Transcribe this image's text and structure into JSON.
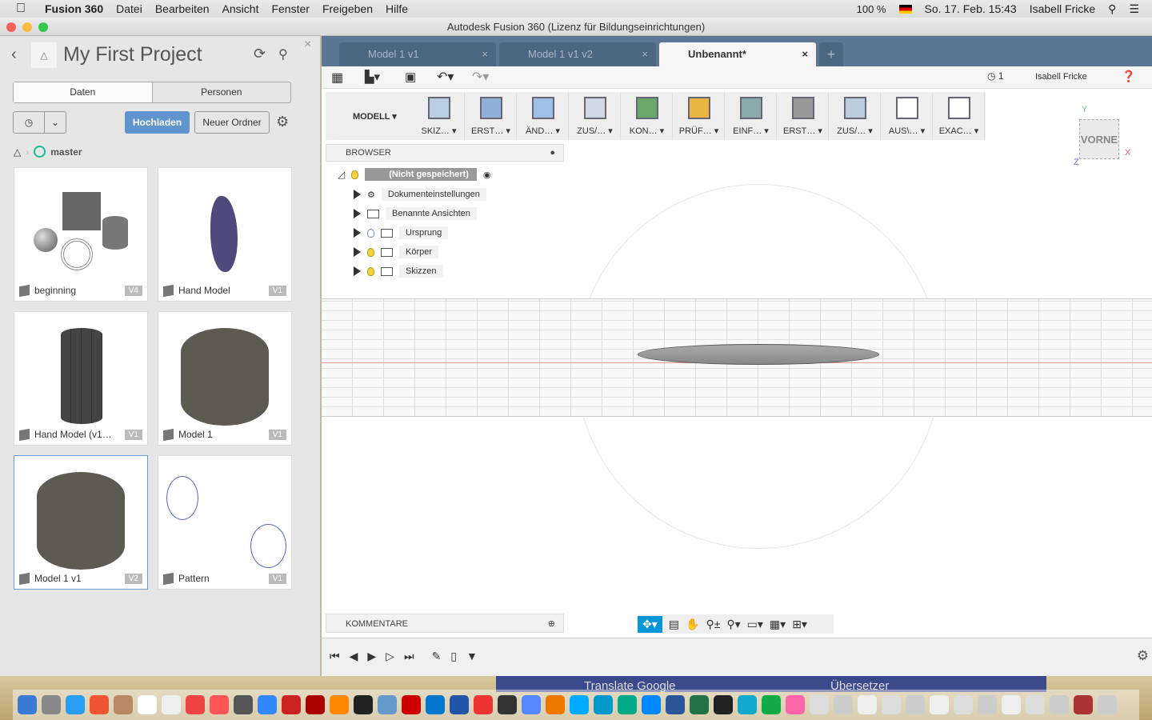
{
  "menubar": {
    "app": "Fusion 360",
    "items": [
      "Datei",
      "Bearbeiten",
      "Ansicht",
      "Fenster",
      "Freigeben",
      "Hilfe"
    ],
    "battery": "100 %",
    "datetime": "So. 17. Feb.  15:43",
    "user": "Isabell Fricke"
  },
  "window": {
    "title": "Autodesk Fusion 360 (Lizenz für Bildungseinrichtungen)"
  },
  "project": {
    "title": "My First Project",
    "tabs": [
      "Daten",
      "Personen"
    ],
    "upload": "Hochladen",
    "new_folder": "Neuer Ordner",
    "branch": "master",
    "files": [
      {
        "name": "beginning",
        "version": "V4"
      },
      {
        "name": "Hand Model",
        "version": "V1"
      },
      {
        "name": "Hand Model (v1…",
        "version": "V1"
      },
      {
        "name": "Model 1",
        "version": "V1"
      },
      {
        "name": "Model 1 v1",
        "version": "V2"
      },
      {
        "name": "Pattern",
        "version": "V1"
      }
    ]
  },
  "doc_tabs": [
    {
      "label": "Model 1 v1"
    },
    {
      "label": "Model 1 v1 v2"
    },
    {
      "label": "Unbenannt*"
    }
  ],
  "qat": {
    "jobs": "1",
    "user": "Isabell Fricke"
  },
  "ribbon": {
    "workspace": "MODELL",
    "groups": [
      "SKIZ…",
      "ERST…",
      "ÄND…",
      "ZUS/…",
      "KON…",
      "PRÜF…",
      "EINF…",
      "ERST…",
      "ZUS/…",
      "AUS\\…",
      "EXAC…"
    ]
  },
  "browser": {
    "title": "BROWSER",
    "root": "(Nicht gespeichert)",
    "items": [
      "Dokumenteinstellungen",
      "Benannte Ansichten",
      "Ursprung",
      "Körper",
      "Skizzen"
    ]
  },
  "viewcube": {
    "face": "VORNE",
    "axes": [
      "Y",
      "X",
      "Z"
    ]
  },
  "comments": {
    "title": "KOMMENTARE"
  },
  "dock": {
    "bg_texts": [
      "Translate Google",
      "Übersetzer"
    ]
  },
  "colors": {
    "accent": "#0696d7",
    "tab_bar": "#5b7794",
    "upload": "#5f95cc",
    "branch": "#1abc9c"
  }
}
